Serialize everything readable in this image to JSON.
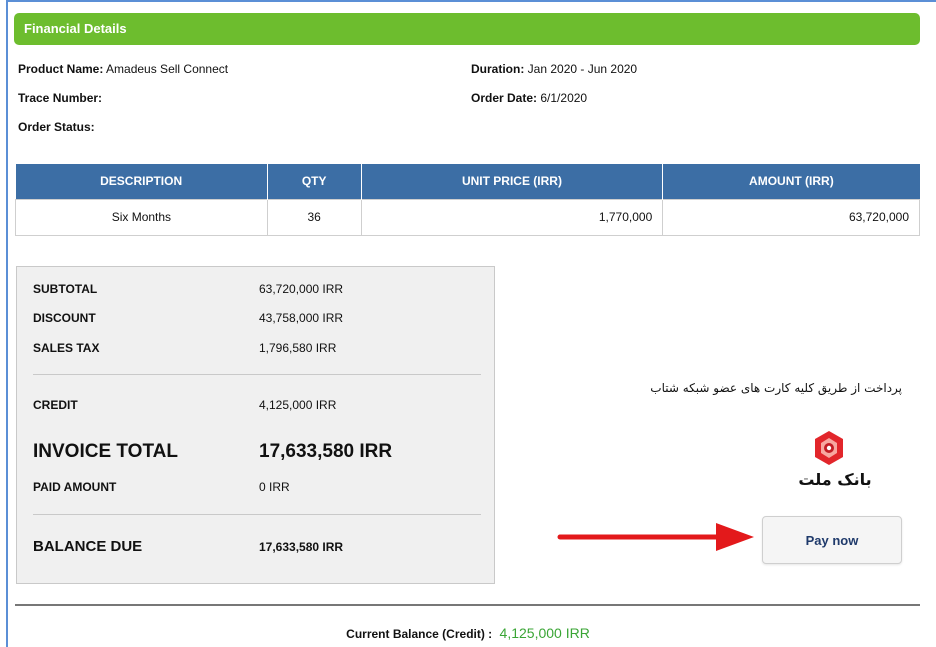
{
  "header": {
    "title": "Financial Details"
  },
  "info": {
    "product_name_label": "Product Name:",
    "product_name": "Amadeus Sell Connect",
    "duration_label": "Duration:",
    "duration": "Jan 2020 - Jun 2020",
    "trace_label": "Trace Number:",
    "trace_value": "",
    "order_date_label": "Order Date:",
    "order_date": "6/1/2020",
    "order_status_label": "Order Status:",
    "order_status": ""
  },
  "items_table": {
    "headers": [
      "DESCRIPTION",
      "QTY",
      "UNIT PRICE (IRR)",
      "AMOUNT (IRR)"
    ],
    "rows": [
      {
        "description": "Six Months",
        "qty": "36",
        "unit_price": "1,770,000",
        "amount": "63,720,000"
      }
    ]
  },
  "summary": {
    "subtotal_label": "SUBTOTAL",
    "subtotal": "63,720,000 IRR",
    "discount_label": "DISCOUNT",
    "discount": "43,758,000 IRR",
    "sales_tax_label": "SALES TAX",
    "sales_tax": "1,796,580 IRR",
    "credit_label": "CREDIT",
    "credit": "4,125,000 IRR",
    "invoice_total_label": "INVOICE TOTAL",
    "invoice_total": "17,633,580 IRR",
    "paid_amount_label": "PAID AMOUNT",
    "paid_amount": "0 IRR",
    "balance_due_label": "BALANCE DUE",
    "balance_due": "17,633,580 IRR"
  },
  "payment": {
    "persian_note": "پرداخت از طریق کلیه کارت های عضو شبکه شتاب",
    "bank_name": "بانک ملت",
    "bank_logo_icon": "bank-mellat-logo-icon",
    "pay_button": "Pay now"
  },
  "footer": {
    "current_balance_label": "Current Balance  (Credit) :",
    "current_balance_value": "4,125,000 IRR"
  },
  "colors": {
    "header_green": "#6dbd2e",
    "table_header_blue": "#3c6ea5",
    "arrow_red": "#e3191b",
    "balance_green": "#3aa535"
  }
}
